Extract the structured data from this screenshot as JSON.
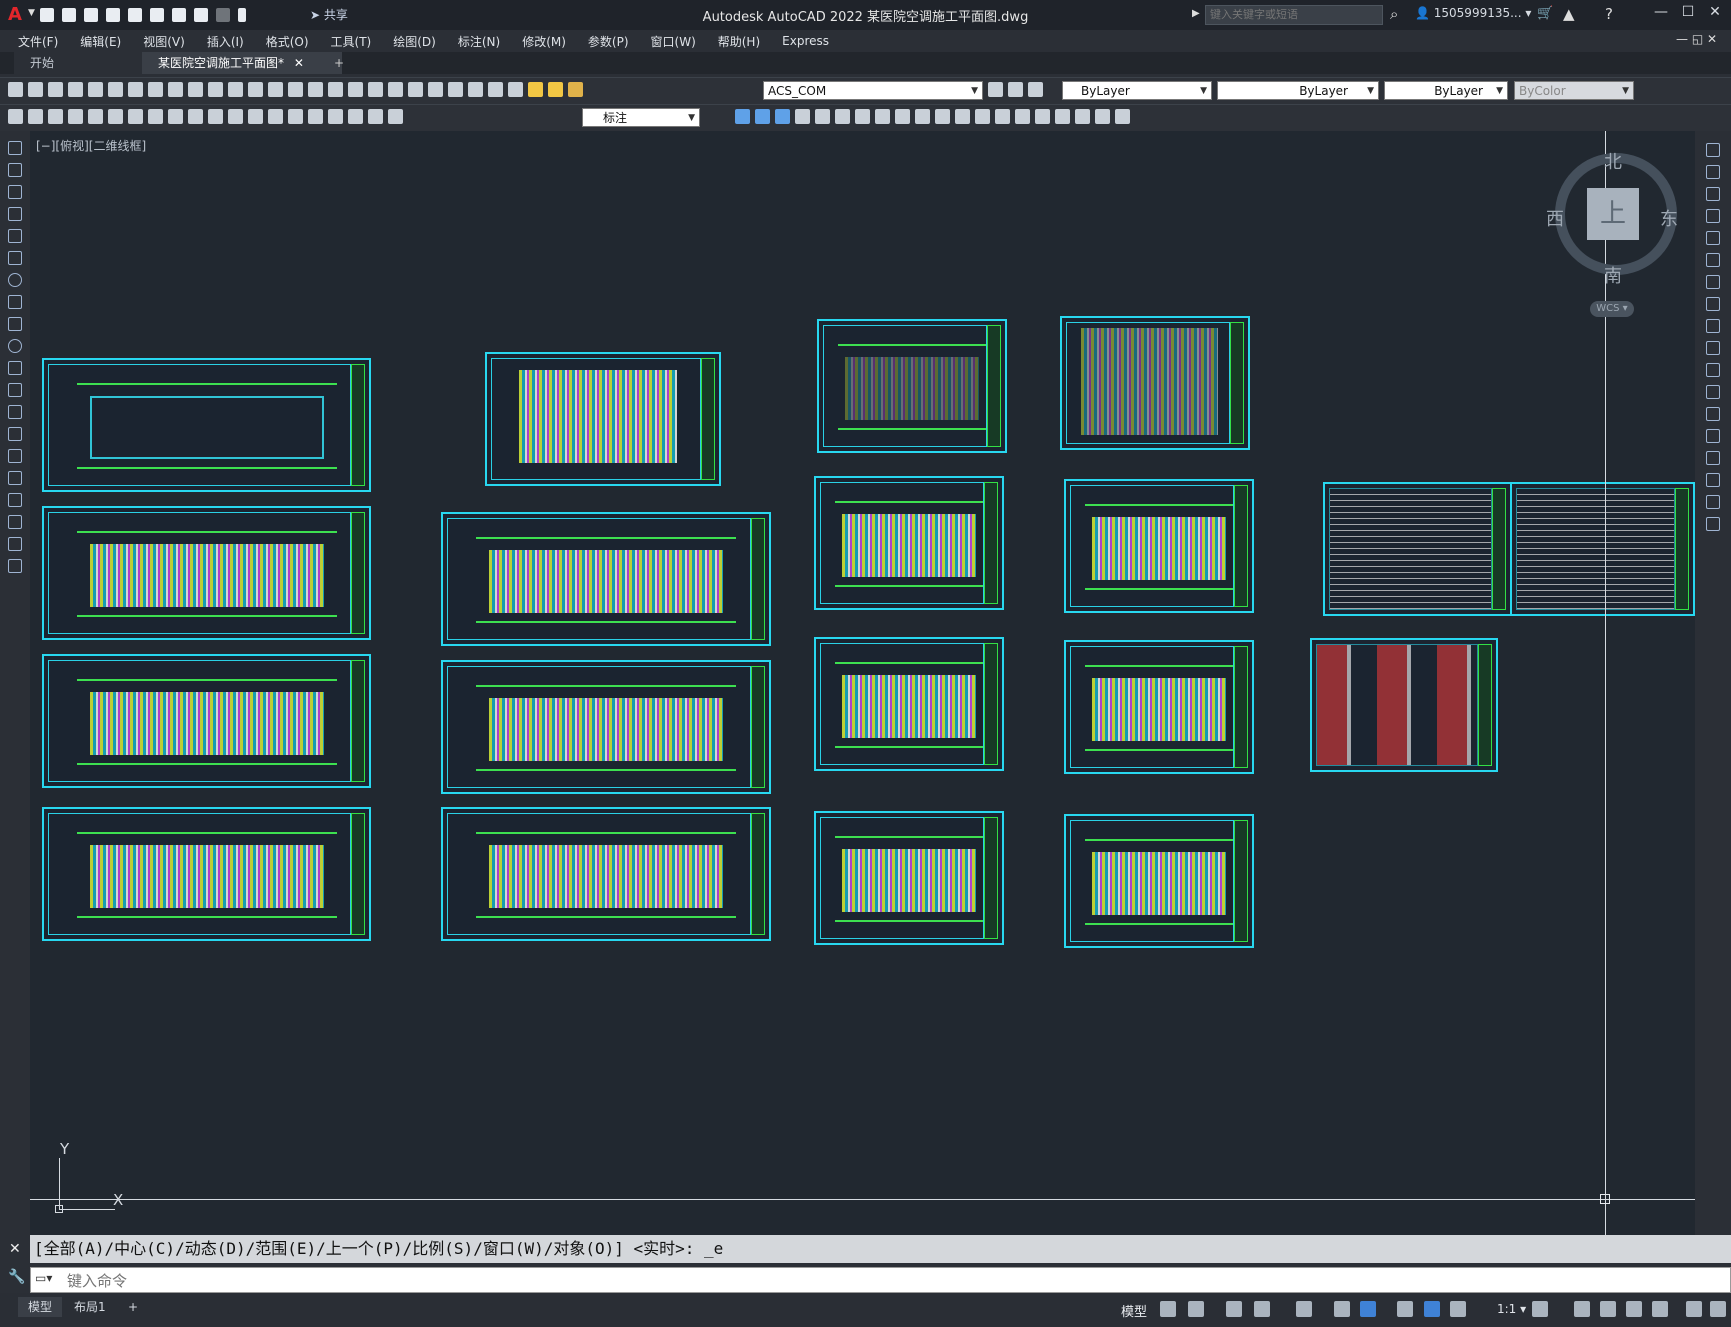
{
  "app": {
    "title": "Autodesk AutoCAD 2022    某医院空调施工平面图.dwg",
    "share_label": "共享",
    "search_placeholder": "键入关键字或短语",
    "user_label": "1505999135...",
    "logo": "A"
  },
  "menu": [
    "文件(F)",
    "编辑(E)",
    "视图(V)",
    "插入(I)",
    "格式(O)",
    "工具(T)",
    "绘图(D)",
    "标注(N)",
    "修改(M)",
    "参数(P)",
    "窗口(W)",
    "帮助(H)",
    "Express"
  ],
  "tabs": {
    "start": "开始",
    "doc": "某医院空调施工平面图*",
    "add": "+"
  },
  "toolbar": {
    "ucs_name": "ACS_COM",
    "color": "ByLayer",
    "linetype": "ByLayer",
    "lineweight": "ByLayer",
    "plotstyle": "ByColor",
    "dimstyle": "标注"
  },
  "viewport": {
    "label": "[−][俯视][二维线框]"
  },
  "viewcube": {
    "face": "上",
    "north": "北",
    "south": "南",
    "east": "东",
    "west": "西",
    "wcs": "WCS"
  },
  "ucs": {
    "x": "X",
    "y": "Y"
  },
  "command": {
    "history": "[全部(A)/中心(C)/动态(D)/范围(E)/上一个(P)/比例(S)/窗口(W)/对象(O)] <实时>: _e",
    "placeholder": "键入命令"
  },
  "status": {
    "model_tab": "模型",
    "layout_tab": "布局1",
    "model_space": "模型",
    "scale": "1:1"
  }
}
